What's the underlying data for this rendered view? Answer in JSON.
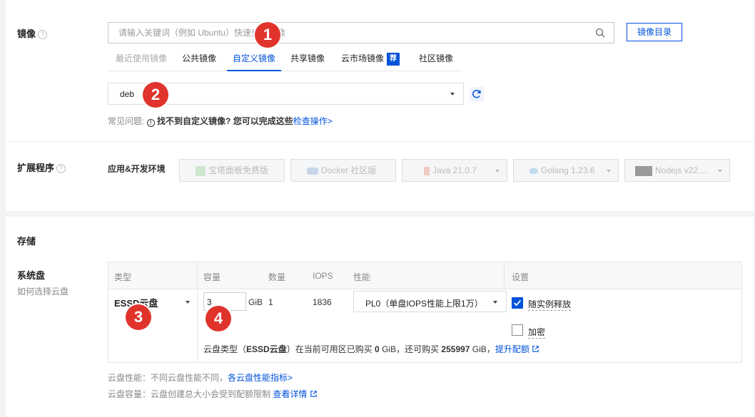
{
  "image_section": {
    "label": "镜像",
    "help_icon": "?",
    "search_placeholder": "请输入关键词（例如 Ubuntu）快速查找镜像",
    "catalog_button": "镜像目录",
    "tabs": [
      {
        "label": "最近使用镜像",
        "state": "disabled"
      },
      {
        "label": "公共镜像",
        "state": "normal"
      },
      {
        "label": "自定义镜像",
        "state": "active"
      },
      {
        "label": "共享镜像",
        "state": "normal"
      },
      {
        "label": "云市场镜像",
        "state": "normal",
        "badge": "荐"
      },
      {
        "label": "社区镜像",
        "state": "normal"
      }
    ],
    "selected_image": "deb",
    "faq_prefix": "常见问题:",
    "faq_text": "找不到自定义镜像? 您可以完成这些",
    "faq_link": "检查操作>"
  },
  "extension_section": {
    "label": "扩展程序",
    "help_icon": "?",
    "group_label": "应用&开发环境",
    "buttons": [
      {
        "label": "宝塔面板免费版",
        "icon": "bt-panel-icon"
      },
      {
        "label": "Docker 社区版",
        "icon": "docker-icon"
      },
      {
        "label": "Java 21.0.7",
        "icon": "java-icon"
      },
      {
        "label": "Golang 1.23.6",
        "icon": "golang-icon"
      },
      {
        "label": "Nodejs v22....",
        "icon": "nodejs-icon"
      }
    ]
  },
  "storage_section": {
    "title": "存储",
    "system_disk_label": "系统盘",
    "system_disk_help": "如何选择云盘",
    "table": {
      "headers": {
        "type": "类型",
        "capacity": "容量",
        "count": "数量",
        "iops": "IOPS",
        "performance": "性能",
        "settings": "设置"
      },
      "row": {
        "type": "ESSD云盘",
        "capacity": "3",
        "unit": "GiB",
        "count": "1",
        "iops": "1836",
        "performance": "PL0（单盘IOPS性能上限1万）",
        "release_with_instance": "随实例释放",
        "release_checked": true,
        "encrypt": "加密",
        "encrypt_checked": false
      },
      "note_prefix": "云盘类型（",
      "note_type": "ESSD云盘",
      "note_mid1": "）在当前可用区已购买 ",
      "note_bought": "0",
      "note_mid2": " GiB，还可购买 ",
      "note_remaining": "255997",
      "note_mid3": " GiB，",
      "note_link": "提升配额"
    },
    "perf_note_text": "云盘性能：不同云盘性能不同，",
    "perf_note_link": "各云盘性能指标>",
    "cap_note_text": "云盘容量：云盘创建总大小会受到配额限制 ",
    "cap_note_link": "查看详情"
  },
  "markers": [
    "1",
    "2",
    "3",
    "4"
  ],
  "colors": {
    "accent": "#0052d9",
    "marker": "#e0332b"
  }
}
